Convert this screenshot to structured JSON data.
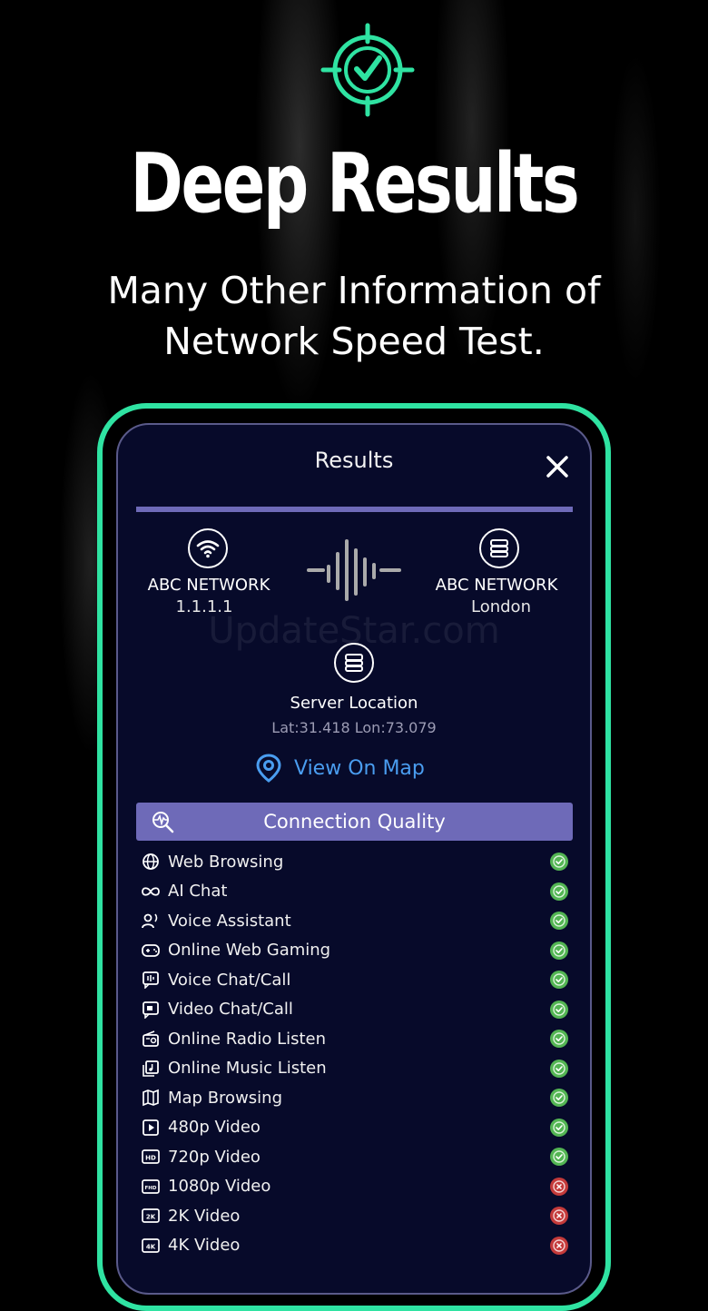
{
  "hero": {
    "title": "Deep Results",
    "subtitle_line1": "Many Other Information of",
    "subtitle_line2": "Network Speed Test."
  },
  "results": {
    "title": "Results",
    "client": {
      "name": "ABC NETWORK",
      "ip": "1.1.1.1"
    },
    "server": {
      "name": "ABC NETWORK",
      "city": "London"
    },
    "location": {
      "label": "Server Location",
      "coords": "Lat:31.418 Lon:73.079"
    },
    "view_on_map": "View On Map",
    "watermark": "UpdateStar.com"
  },
  "connection_quality": {
    "title": "Connection Quality",
    "items": [
      {
        "label": "Web Browsing",
        "icon": "globe-icon",
        "status": "ok"
      },
      {
        "label": "AI Chat",
        "icon": "infinity-icon",
        "status": "ok"
      },
      {
        "label": "Voice Assistant",
        "icon": "voice-assistant-icon",
        "status": "ok"
      },
      {
        "label": "Online Web Gaming",
        "icon": "gamepad-icon",
        "status": "ok"
      },
      {
        "label": "Voice Chat/Call",
        "icon": "voice-chat-icon",
        "status": "ok"
      },
      {
        "label": "Video Chat/Call",
        "icon": "video-chat-icon",
        "status": "ok"
      },
      {
        "label": "Online Radio Listen",
        "icon": "radio-icon",
        "status": "ok"
      },
      {
        "label": "Online Music Listen",
        "icon": "music-icon",
        "status": "ok"
      },
      {
        "label": "Map Browsing",
        "icon": "map-icon",
        "status": "ok"
      },
      {
        "label": "480p Video",
        "icon": "play-icon",
        "status": "ok"
      },
      {
        "label": "720p Video",
        "icon": "hd-icon",
        "status": "ok"
      },
      {
        "label": "1080p Video",
        "icon": "fhd-icon",
        "status": "fail"
      },
      {
        "label": "2K Video",
        "icon": "2k-icon",
        "status": "fail"
      },
      {
        "label": "4K Video",
        "icon": "4k-icon",
        "status": "fail"
      }
    ]
  },
  "colors": {
    "accent_green": "#2fe3a2",
    "panel_bg": "#070a2a",
    "header_bar": "#6e6ab8",
    "link_blue": "#4a9df0",
    "status_ok": "#53b553",
    "status_fail": "#c43a3a"
  }
}
